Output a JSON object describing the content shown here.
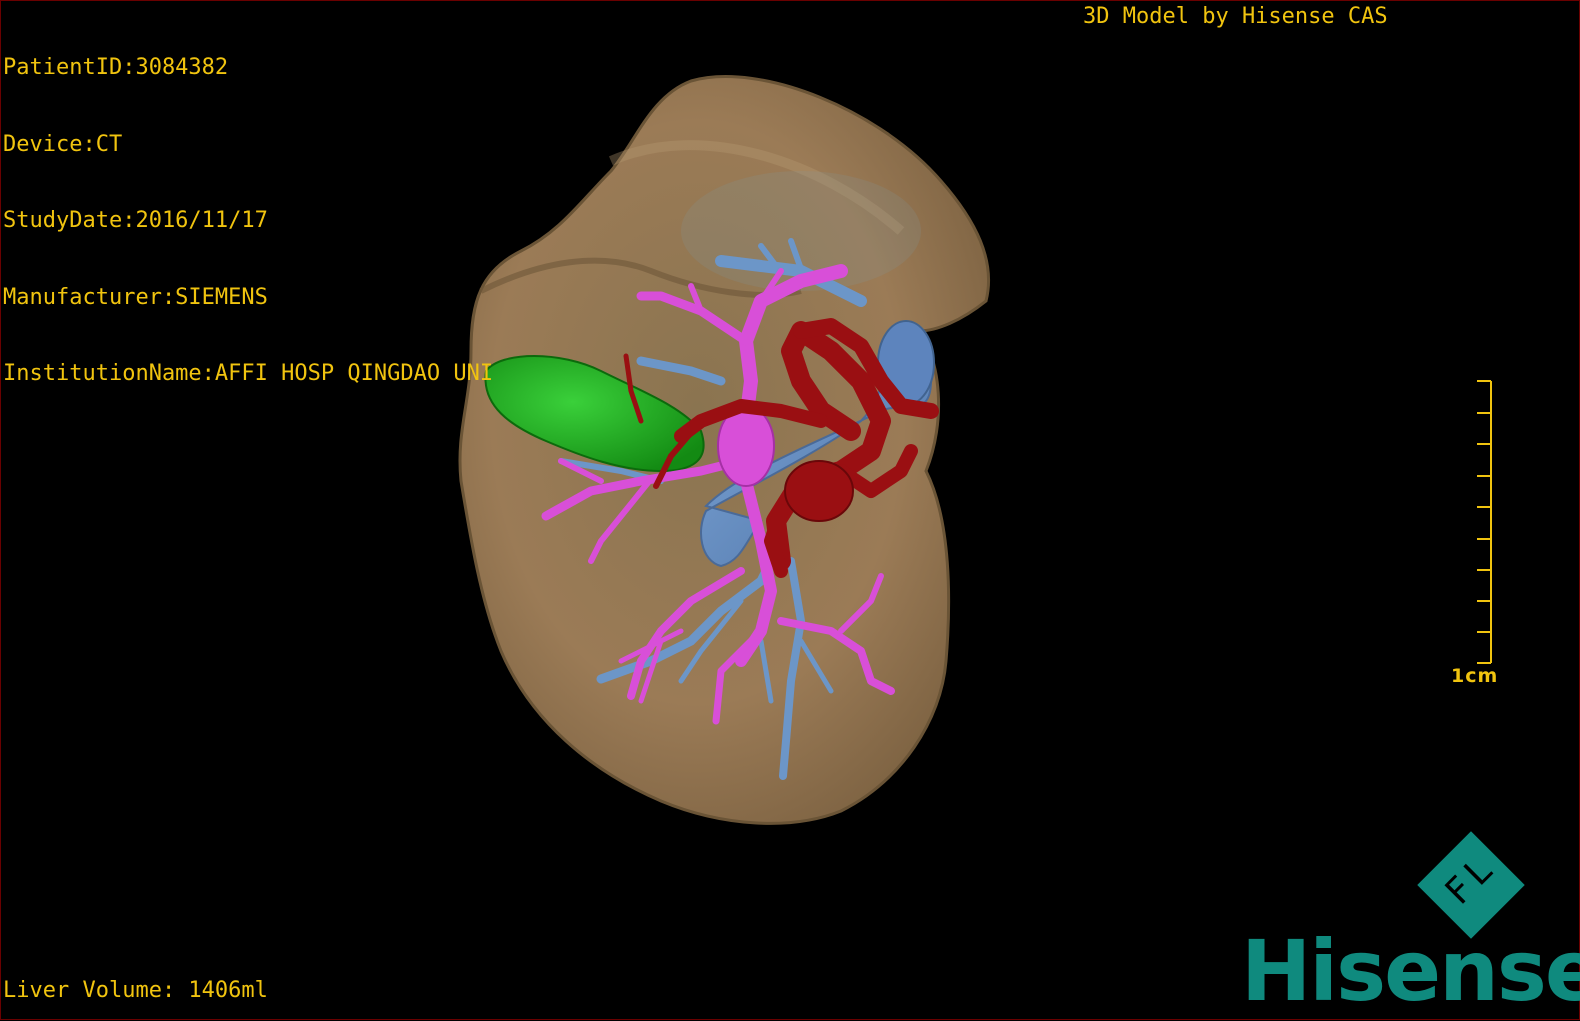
{
  "header": {
    "patient_id": "PatientID:3084382",
    "device": "Device:CT",
    "study_date": "StudyDate:2016/11/17",
    "manufacturer": "Manufacturer:SIEMENS",
    "institution": "InstitutionName:AFFI HOSP QINGDAO UNI",
    "credit": "3D Model by Hisense CAS"
  },
  "footer": {
    "liver_volume": "Liver Volume: 1406ml"
  },
  "scale_bar": {
    "label": "1cm"
  },
  "brand": {
    "name": "Hisense",
    "logo_letters": "FL",
    "color": "#0f8a7e"
  },
  "colors": {
    "overlay_text": "#f1c40f",
    "liver": "#9b7b56",
    "gallbladder": "#1fa81f",
    "portal_vein": "#d84fd8",
    "hepatic_vein": "#6c96c8",
    "artery": "#9a0f12"
  }
}
